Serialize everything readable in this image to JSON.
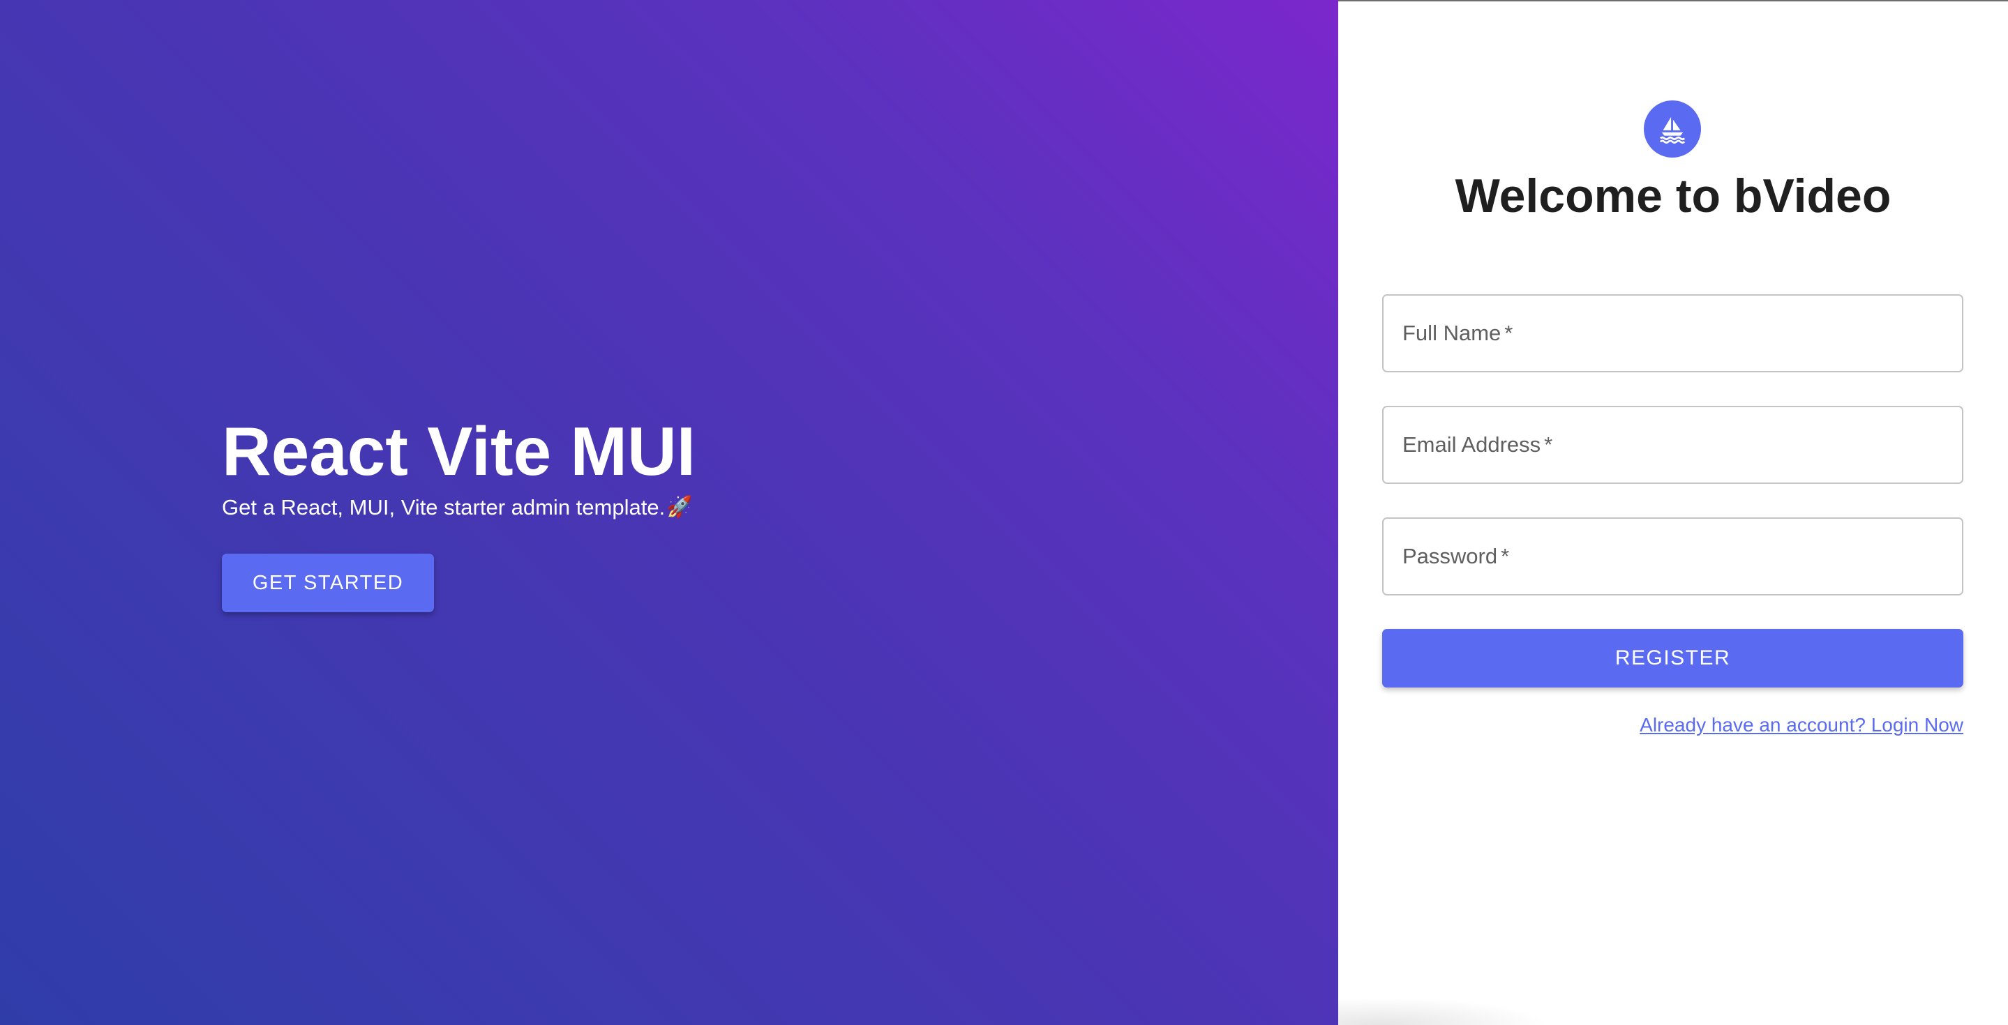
{
  "hero": {
    "title": "React Vite MUI",
    "subtitle": "Get a React, MUI, Vite starter admin template.",
    "subtitle_icon": "rocket-icon",
    "get_started_label": "GET STARTED",
    "gradient_colors": [
      "#7b27cc",
      "#2f3da9"
    ]
  },
  "register": {
    "logo_icon": "sailboat-icon",
    "title": "Welcome to bVideo",
    "fields": [
      {
        "label": "Full Name",
        "required_mark": "*",
        "value": ""
      },
      {
        "label": "Email Address",
        "required_mark": "*",
        "value": ""
      },
      {
        "label": "Password",
        "required_mark": "*",
        "value": ""
      }
    ],
    "register_label": "REGISTER",
    "login_link": "Already have an account? Login Now"
  },
  "colors": {
    "accent": "#5a6bf2",
    "title_text": "#1f1f1f",
    "label_text": "#5f5f5f"
  }
}
